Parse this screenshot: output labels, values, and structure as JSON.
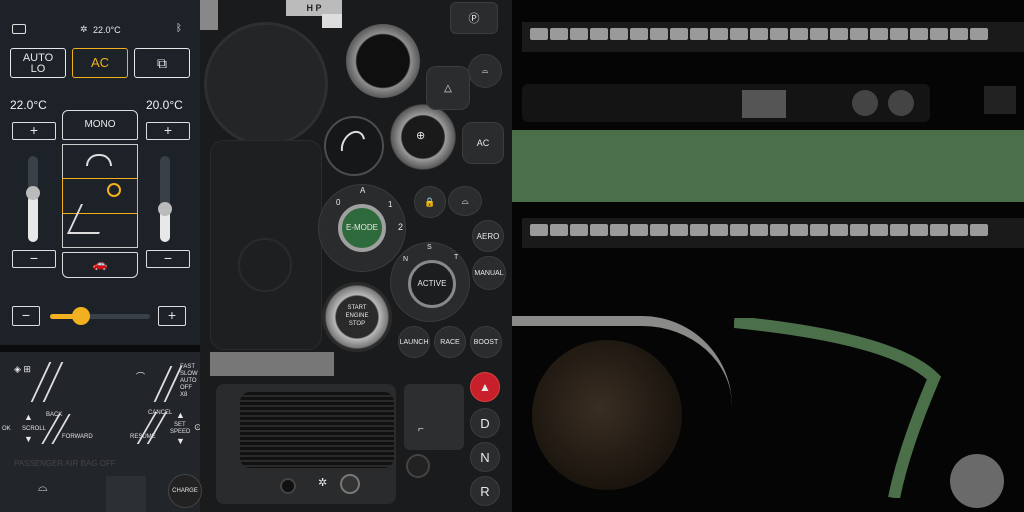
{
  "climate": {
    "status_temp": "22.0°C",
    "auto_label": "AUTO",
    "auto_sub": "LO",
    "ac_label": "AC",
    "left_temp": "22.0°C",
    "right_temp": "20.0°C",
    "plus": "+",
    "minus": "−",
    "mono_label": "MONO",
    "left_level": 0.55,
    "right_level": 0.45,
    "fan_level": 0.3
  },
  "stalks": {
    "fast_label": "FAST",
    "slow_label": "SLOW",
    "auto_label": "AUTO",
    "off_label": "OFF",
    "x8_label": "X8",
    "ok_label": "OK",
    "scroll_label": "SCROLL",
    "back_label": "BACK",
    "forward_label": "FORWARD",
    "cancel_label": "CANCEL",
    "resume_label": "RESUME",
    "set_label": "SET",
    "speed_label": "SPEED",
    "airbag_label": "PASSENGER AIR BAG OFF",
    "charge_label": "CHARGE"
  },
  "console": {
    "hp_label": "H  P",
    "emode_label": "E-MODE",
    "dial_a": "A",
    "dial_0": "0",
    "dial_1": "1",
    "dial_2": "2",
    "active_label": "ACTIVE",
    "active_n": "N",
    "active_s": "S",
    "active_t": "T",
    "start_line1": "START",
    "start_line2": "ENGINE",
    "start_line3": "STOP",
    "ac_label": "AC",
    "aero_label": "AERO",
    "manual_label": "MANUAL",
    "launch_label": "LAUNCH",
    "race_label": "RACE",
    "boost_label": "BOOST",
    "gear_d": "D",
    "gear_n": "N",
    "gear_r": "R"
  },
  "colors": {
    "accent": "#f0b020",
    "panel": "#1c2228",
    "green": "#4a6f49",
    "hazard": "#c8202a"
  }
}
